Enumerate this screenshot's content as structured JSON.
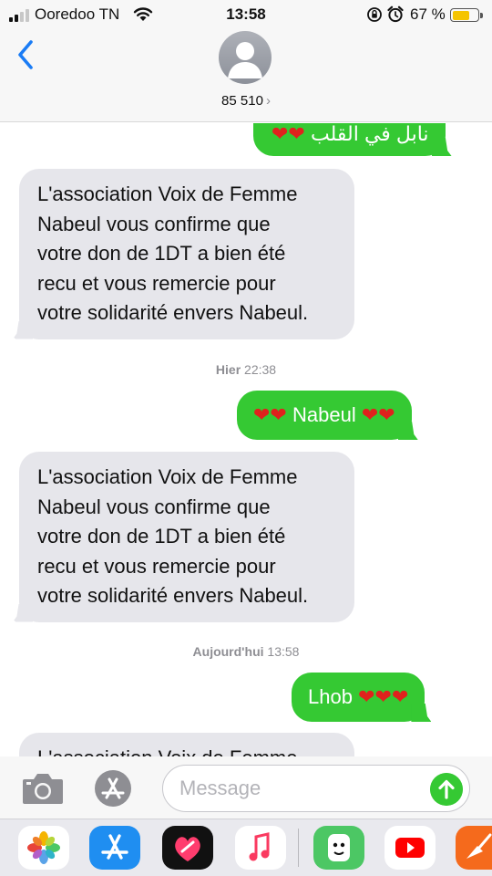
{
  "status_bar": {
    "carrier": "Ooredoo TN",
    "time": "13:58",
    "battery_percent": "67 %",
    "battery_level": 0.67,
    "icons": [
      "signal-icon",
      "wifi-icon",
      "rotation-lock-icon",
      "alarm-icon",
      "battery-icon"
    ]
  },
  "header": {
    "contact": "85 510",
    "contact_chevron": "›",
    "icons": [
      "back-chevron-icon",
      "contact-avatar-icon"
    ]
  },
  "conversation": {
    "partial_top_message": "نابل في القلب",
    "messages": [
      {
        "direction": "incoming",
        "lines": [
          "L'association Voix de Femme",
          "Nabeul vous confirme que",
          "votre don de 1DT a bien été",
          "recu et vous remercie pour",
          "votre solidarité envers Nabeul."
        ]
      },
      {
        "timestamp_day": "Hier",
        "timestamp_time": "22:38"
      },
      {
        "direction": "outgoing",
        "text": "Nabeul"
      },
      {
        "direction": "incoming",
        "lines": [
          "L'association Voix de Femme",
          "Nabeul vous confirme que",
          "votre don de 1DT a bien été",
          "recu et vous remercie pour",
          "votre solidarité envers Nabeul."
        ]
      },
      {
        "timestamp_day": "Aujourd'hui",
        "timestamp_time": "13:58"
      },
      {
        "direction": "outgoing",
        "text": "Lhob"
      },
      {
        "direction": "incoming",
        "partial_text": "L'association Voix de Femme"
      }
    ],
    "heart_glyph": "❤",
    "colors": {
      "outgoing": "#35c933",
      "incoming": "#e6e6eb",
      "heart": "#e0221d"
    }
  },
  "input_bar": {
    "placeholder": "Message",
    "icons": [
      "camera-icon",
      "app-store-icon",
      "send-arrow-icon"
    ]
  },
  "app_drawer": {
    "apps": [
      "photos-icon",
      "app-store-icon",
      "digital-touch-icon",
      "music-icon",
      "animoji-icon",
      "youtube-icon",
      "garageband-icon"
    ]
  }
}
